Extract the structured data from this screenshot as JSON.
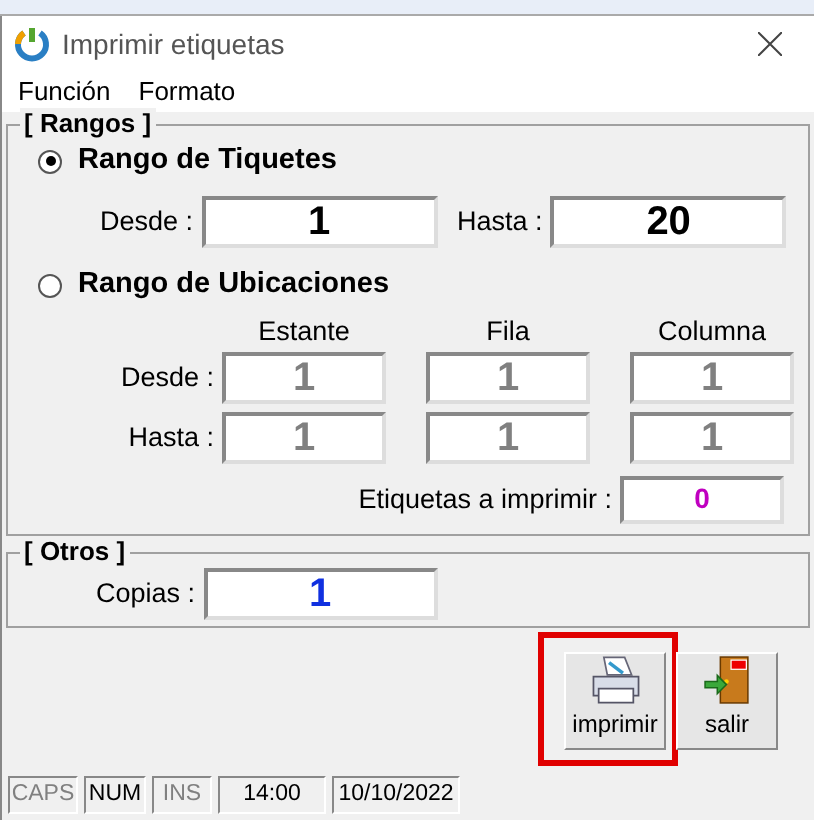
{
  "window": {
    "title": "Imprimir etiquetas"
  },
  "menu": [
    {
      "label": "Función"
    },
    {
      "label": "Formato"
    }
  ],
  "rangos": {
    "title": "[ Rangos ]",
    "options": [
      {
        "label": "Rango de Tiquetes",
        "selected": true
      },
      {
        "label": "Rango de Ubicaciones",
        "selected": false
      }
    ],
    "tiquetes": {
      "desde_label": "Desde :",
      "desde": "1",
      "hasta_label": "Hasta :",
      "hasta": "20"
    },
    "ubicaciones": {
      "disabled": true,
      "columns": [
        "Estante",
        "Fila",
        "Columna"
      ],
      "rows": [
        {
          "label": "Desde :",
          "values": [
            "1",
            "1",
            "1"
          ]
        },
        {
          "label": "Hasta :",
          "values": [
            "1",
            "1",
            "1"
          ]
        }
      ]
    },
    "total": {
      "label": "Etiquetas a imprimir :",
      "value": "0"
    }
  },
  "otros": {
    "title": "[ Otros ]",
    "copias_label": "Copias :",
    "copias": "1"
  },
  "buttons": [
    {
      "kind": "print",
      "label": "imprimir",
      "highlighted": true
    },
    {
      "kind": "exit",
      "label": "salir",
      "highlighted": false
    }
  ],
  "status_bar": [
    {
      "kind": "key",
      "label": "CAPS",
      "on": false
    },
    {
      "kind": "key",
      "label": "NUM",
      "on": true
    },
    {
      "kind": "key",
      "label": "INS",
      "on": false
    },
    {
      "kind": "info",
      "label": "14:00"
    },
    {
      "kind": "info",
      "label": "10/10/2022"
    }
  ]
}
